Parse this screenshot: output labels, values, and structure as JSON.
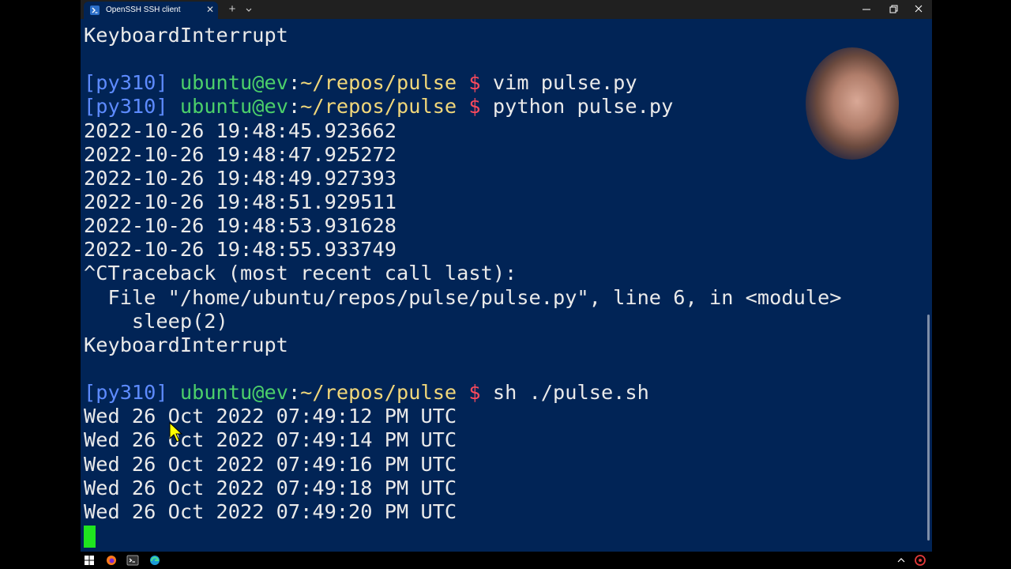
{
  "tab": {
    "title": "OpenSSH SSH client",
    "close": "✕"
  },
  "titlebar": {
    "new_tab": "+"
  },
  "icons": {
    "tab": "powershell-icon",
    "dropdown": "chevron-down-icon",
    "minimize": "minimize-icon",
    "maximize": "restore-icon",
    "close": "close-icon",
    "start": "windows-start-icon",
    "firefox": "firefox-icon",
    "terminal": "terminal-icon",
    "edge": "edge-icon",
    "tray_chevron": "chevron-up-icon",
    "tray_app": "tray-app-icon"
  },
  "colors": {
    "background": "#012456",
    "prompt_env": "#5d8bff",
    "prompt_user": "#4cd06a",
    "prompt_path": "#f1d77a",
    "prompt_dollar": "#ff4a5c",
    "cursor": "#1fe51f"
  },
  "prompt": {
    "env": "[py310]",
    "user": "ubuntu@ev",
    "colon": ":",
    "path": "~/repos/pulse",
    "dollar": "$"
  },
  "terminal": {
    "lines": [
      "KeyboardInterrupt",
      "",
      "vim pulse.py",
      "python pulse.py",
      "2022-10-26 19:48:45.923662",
      "2022-10-26 19:48:47.925272",
      "2022-10-26 19:48:49.927393",
      "2022-10-26 19:48:51.929511",
      "2022-10-26 19:48:53.931628",
      "2022-10-26 19:48:55.933749",
      "^CTraceback (most recent call last):",
      "  File \"/home/ubuntu/repos/pulse/pulse.py\", line 6, in <module>",
      "    sleep(2)",
      "KeyboardInterrupt",
      "",
      "sh ./pulse.sh",
      "Wed 26 Oct 2022 07:49:12 PM UTC",
      "Wed 26 Oct 2022 07:49:14 PM UTC",
      "Wed 26 Oct 2022 07:49:16 PM UTC",
      "Wed 26 Oct 2022 07:49:18 PM UTC",
      "Wed 26 Oct 2022 07:49:20 PM UTC"
    ]
  }
}
